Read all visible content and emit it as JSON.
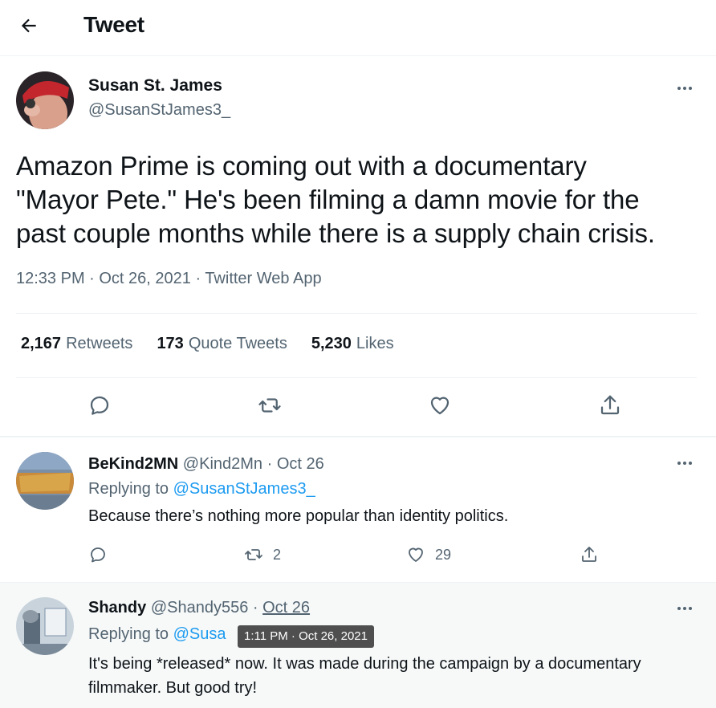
{
  "header": {
    "title": "Tweet",
    "back_icon": "arrow-left-icon"
  },
  "tweet": {
    "author_name": "Susan St. James",
    "author_handle": "@SusanStJames3_",
    "text": "Amazon Prime is coming out with a documentary\n\"Mayor Pete.\" He's been filming a damn  movie for the\npast couple months while there is a supply chain crisis.",
    "timestamp": "12:33 PM · Oct 26, 2021 · Twitter Web App",
    "stats": {
      "retweets_count": "2,167",
      "retweets_label": "Retweets",
      "quotes_count": "173",
      "quotes_label": "Quote Tweets",
      "likes_count": "5,230",
      "likes_label": "Likes"
    }
  },
  "replies": [
    {
      "name": "BeKind2MN",
      "handle": "@Kind2Mn",
      "date": "· Oct 26",
      "replying_prefix": "Replying to",
      "replying_to": "@SusanStJames3_",
      "text": "Because there’s nothing more popular than identity politics.",
      "retweets": "2",
      "likes": "29"
    },
    {
      "name": "Shandy",
      "handle": "@Shandy556",
      "date_sep": "·",
      "date": "Oct 26",
      "replying_prefix": "Replying to",
      "replying_to": "@Susa",
      "text": "It's being *released* now. It was made during the campaign by a documentary filmmaker. But good try!",
      "tooltip": "1:11 PM · Oct 26, 2021"
    }
  ],
  "colors": {
    "accent": "#1d9bf0",
    "secondary_text": "#536471",
    "divider": "#eff3f4",
    "reply_hover_bg": "#f7f9f9"
  }
}
